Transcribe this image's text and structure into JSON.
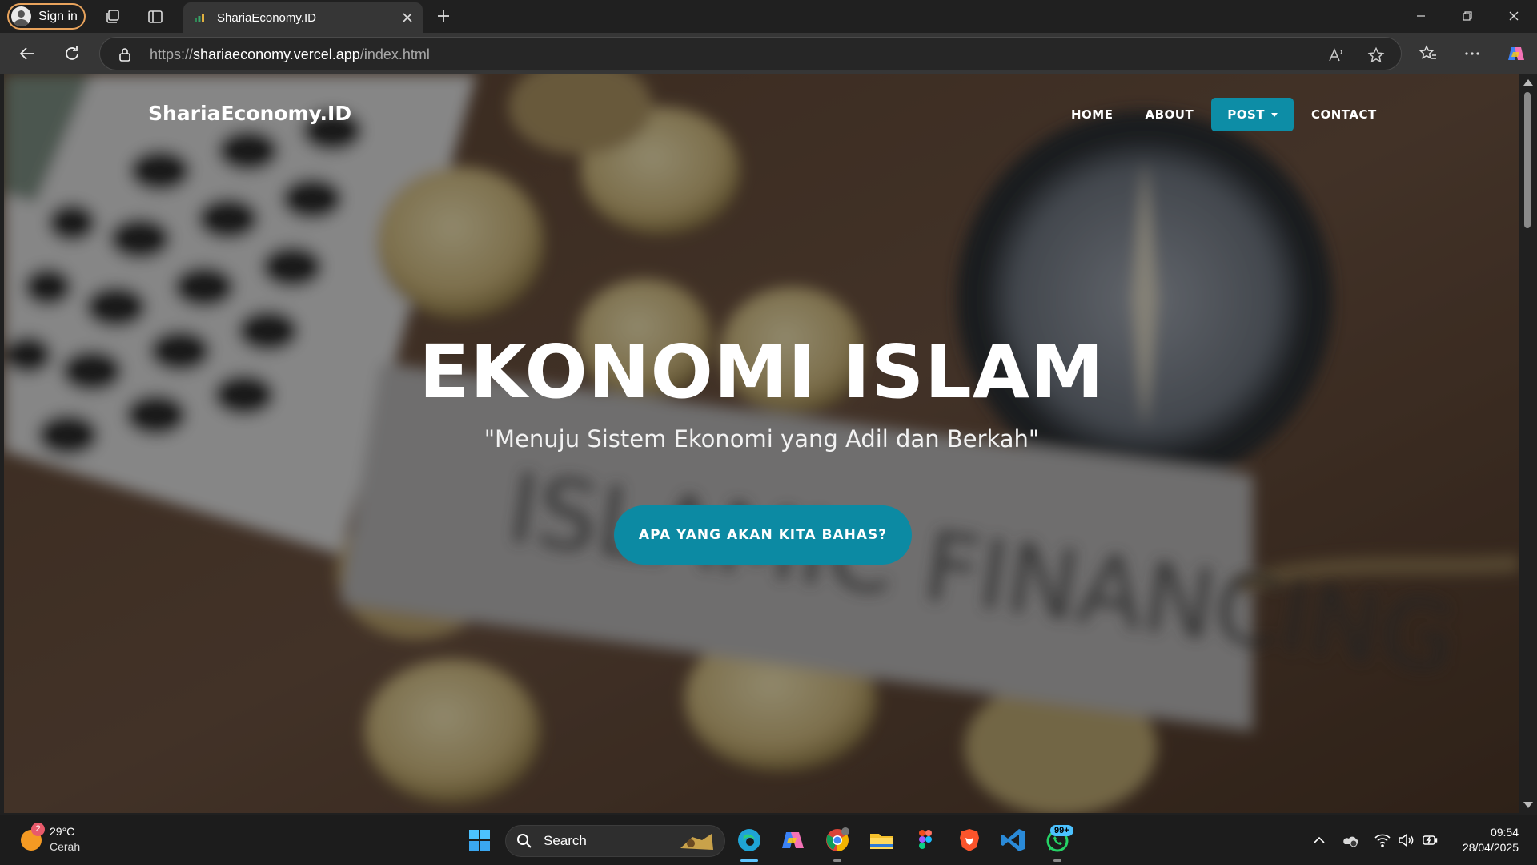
{
  "browser": {
    "signin_label": "Sign in",
    "tab_title": "ShariaEconomy.ID",
    "url_scheme": "https://",
    "url_host": "shariaeconomy.vercel.app",
    "url_path": "/index.html"
  },
  "site": {
    "brand": "ShariaEconomy.ID",
    "nav": [
      {
        "label": "HOME"
      },
      {
        "label": "ABOUT"
      },
      {
        "label": "POST"
      },
      {
        "label": "CONTACT"
      }
    ],
    "hero_title": "EKONOMI ISLAM",
    "hero_subtitle": "\"Menuju Sistem Ekonomi yang Adil dan Berkah\"",
    "cta_label": "APA YANG AKAN KITA BAHAS?",
    "background_sign_text": "ISLAMIC FINANCING",
    "accent_color": "#0d8da6"
  },
  "taskbar": {
    "weather_badge": "2",
    "temperature": "29°C",
    "weather_desc": "Cerah",
    "search_label": "Search",
    "whatsapp_badge": "99+",
    "time": "09:54",
    "date": "28/04/2025"
  }
}
